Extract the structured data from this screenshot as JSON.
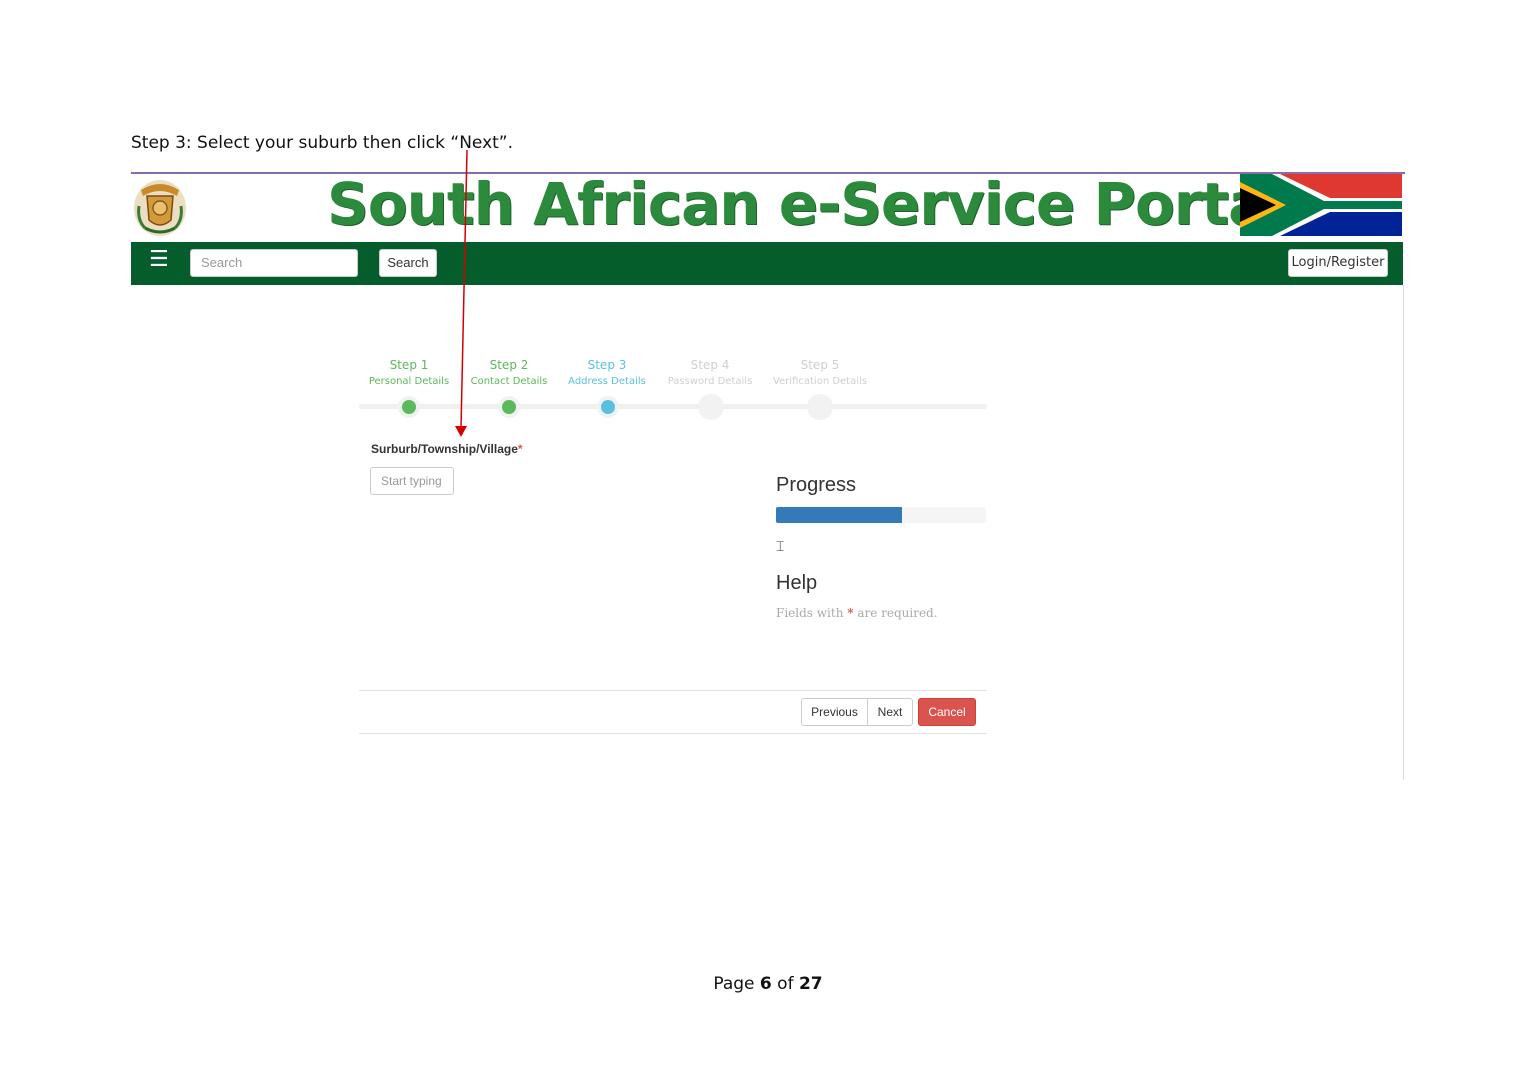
{
  "instruction": {
    "text": "Step 3: Select your suburb then click “Next”."
  },
  "header": {
    "title": "South African e-Service Portal",
    "coat_icon": "coat-of-arms-icon",
    "flag_icon": "south-africa-flag-icon"
  },
  "navbar": {
    "menu_icon": "hamburger-menu-icon",
    "menu_glyph": "☰",
    "search_placeholder": "Search",
    "search_button": "Search",
    "login_button": "Login/Register"
  },
  "steps": [
    {
      "title": "Step 1",
      "subtitle": "Personal Details",
      "state": "done"
    },
    {
      "title": "Step 2",
      "subtitle": "Contact Details",
      "state": "done"
    },
    {
      "title": "Step 3",
      "subtitle": "Address Details",
      "state": "active"
    },
    {
      "title": "Step 4",
      "subtitle": "Password Details",
      "state": "todo"
    },
    {
      "title": "Step 5",
      "subtitle": "Verification Details",
      "state": "todo"
    }
  ],
  "form": {
    "field_label": "Surburb/Township/Village",
    "required_mark": "*",
    "field_placeholder": "Start typing"
  },
  "sidebar": {
    "progress_title": "Progress",
    "progress_fraction": 0.6,
    "cursor_glyph": "⌶",
    "help_title": "Help",
    "help_prefix": "Fields with ",
    "help_star": "*",
    "help_suffix": " are required."
  },
  "buttons": {
    "previous": "Previous",
    "next": "Next",
    "cancel": "Cancel"
  },
  "footer": {
    "page_prefix": "Page ",
    "page_current": "6",
    "page_of": " of ",
    "page_total": "27"
  },
  "colors": {
    "nav_green": "#045d2b",
    "title_green": "#2c8a3c",
    "step_done": "#5cb85c",
    "step_active": "#5bc0de",
    "progress_blue": "#337ab7",
    "cancel_red": "#d9534f",
    "annotation_arrow": "#d40000"
  }
}
